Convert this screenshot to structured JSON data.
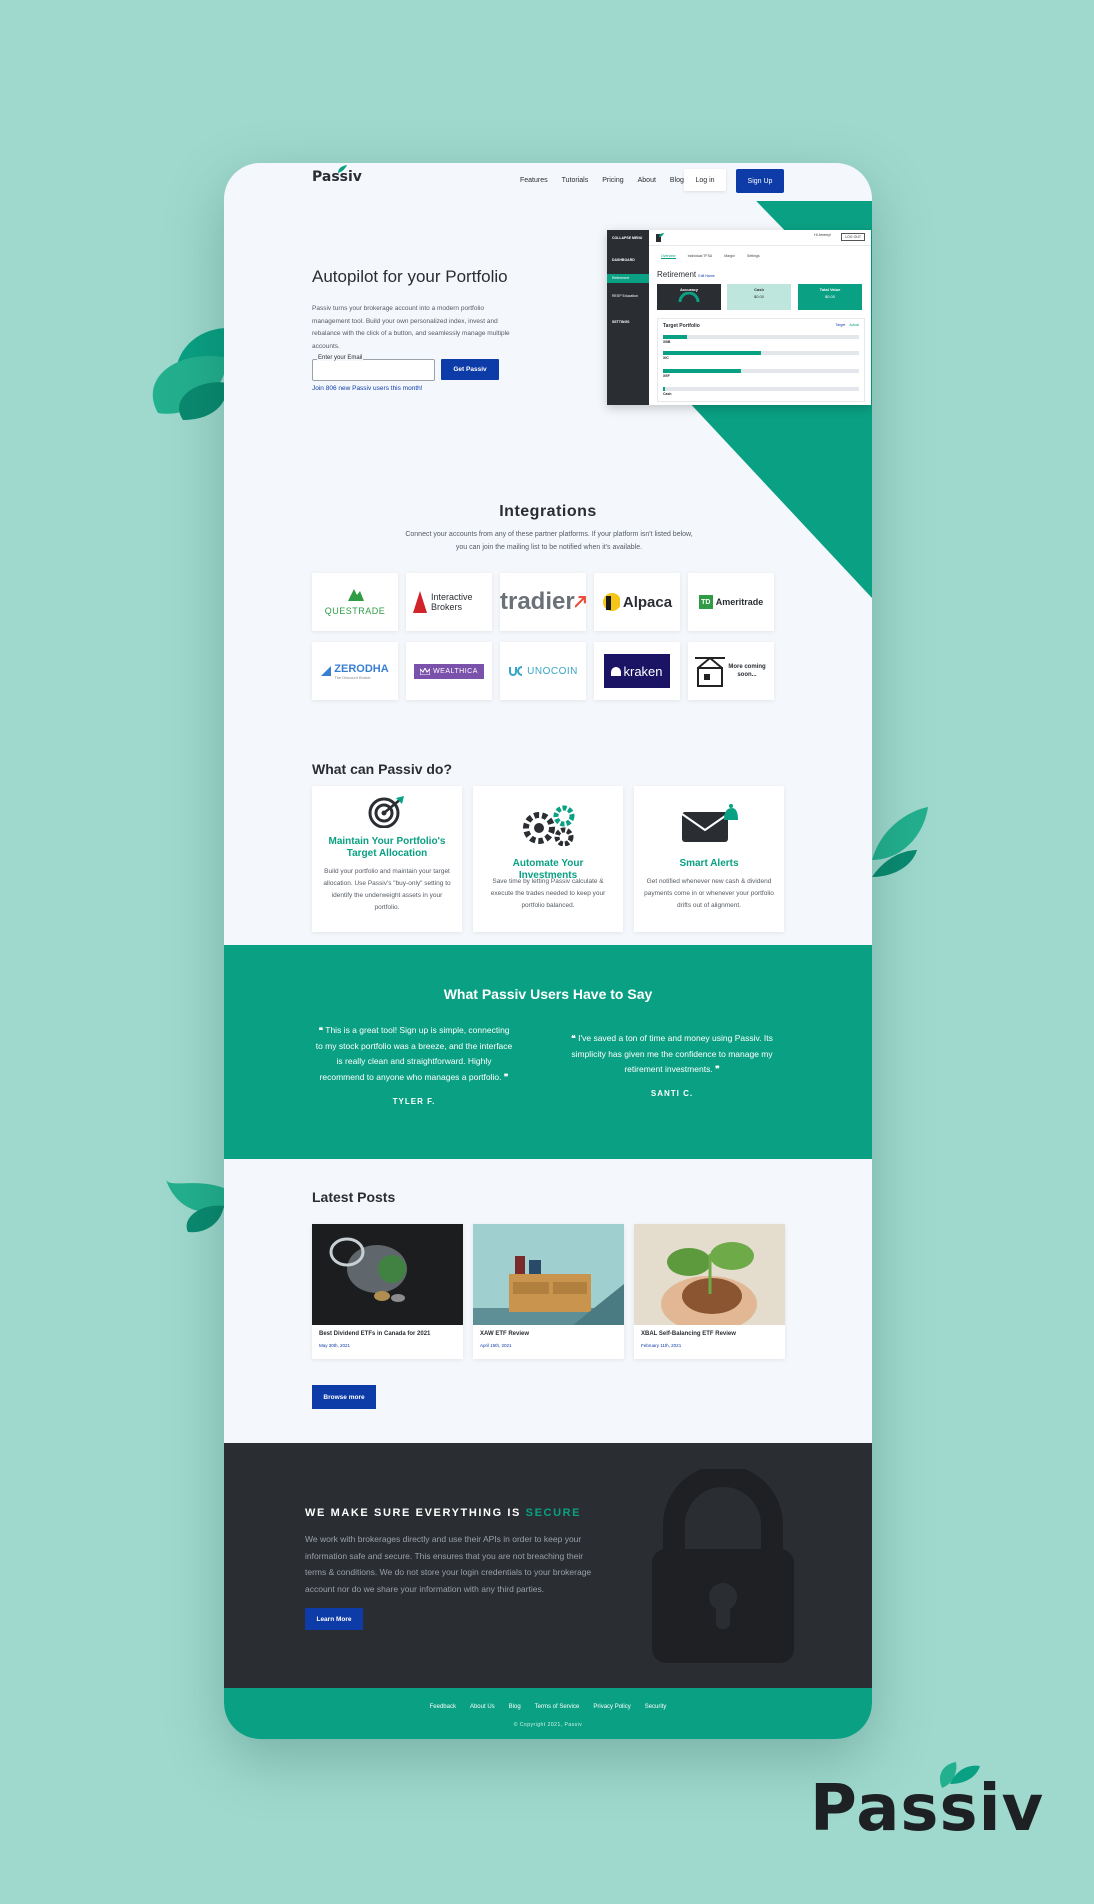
{
  "brand": "Passiv",
  "nav": {
    "links": [
      "Features",
      "Tutorials",
      "Pricing",
      "About",
      "Blog"
    ],
    "login": "Log in",
    "signup": "Sign Up"
  },
  "hero": {
    "title": "Autopilot for your Portfolio",
    "description": "Passiv turns your brokerage account into a modern portfolio management tool. Build your own personalized index, invest and rebalance with the click of a button, and seamlessly manage multiple accounts.",
    "email_label": "Enter your Email",
    "email_value": "",
    "cta": "Get Passiv",
    "join_text": "Join 806 new Passiv users this month!"
  },
  "dashboard": {
    "menu": "COLLAPSE MENU",
    "side_items": [
      "DASHBOARD",
      "Retirement",
      "RESP Education",
      "SETTINGS"
    ],
    "user": "Hi Jeremy!",
    "logout": "LOG OUT",
    "tabs": [
      "Overview",
      "Individual TFSA",
      "Margin",
      "Settings"
    ],
    "title": "Retirement",
    "title_link": "Edit Name",
    "cards": [
      {
        "label": "Accuracy",
        "value": ""
      },
      {
        "label": "Cash",
        "value": "$0.00"
      },
      {
        "label": "Total Value",
        "value": "$0.00"
      }
    ],
    "target_title": "Target Portfolio",
    "legend": [
      "Target",
      "Actual"
    ],
    "holdings": [
      {
        "symbol": "XBB",
        "fill": 0.12
      },
      {
        "symbol": "XIC",
        "fill": 0.5
      },
      {
        "symbol": "XEF",
        "fill": 0.4
      },
      {
        "symbol": "Cash",
        "fill": 0.01
      }
    ]
  },
  "integrations": {
    "title": "Integrations",
    "description": "Connect your accounts from any of these partner platforms. If your platform isn't listed below, you can join the mailing list to be notified when it's available.",
    "partners": [
      "QUESTRADE",
      "Interactive Brokers",
      "tradier",
      "Alpaca",
      "Ameritrade",
      "ZERODHA",
      "WEALTHICA",
      "UNOCOIN",
      "kraken",
      "More coming soon..."
    ],
    "zerodha_sub": "The Discount Broker",
    "td_badge": "TD"
  },
  "features": {
    "title": "What can Passiv do?",
    "items": [
      {
        "title": "Maintain Your Portfolio's Target Allocation",
        "text": "Build your portfolio and maintain your target allocation. Use Passiv's \"buy-only\" setting to identify the underweight assets in your portfolio."
      },
      {
        "title": "Automate Your Investments",
        "text": "Save time by letting Passiv calculate & execute the trades needed to keep your portfolio balanced."
      },
      {
        "title": "Smart Alerts",
        "text": "Get notified whenever new cash & dividend payments come in or whenever your portfolio drifts out of alignment."
      }
    ]
  },
  "testimonials": {
    "title": "What Passiv Users Have to Say",
    "items": [
      {
        "quote": "This is a great tool! Sign up is simple, connecting to my stock portfolio was a breeze, and the interface is really clean and straightforward. Highly recommend to anyone who manages a portfolio.",
        "name": "TYLER F."
      },
      {
        "quote": "I've saved a ton of time and money using Passiv. Its simplicity has given me the confidence to manage my retirement investments.",
        "name": "SANTI C."
      }
    ]
  },
  "posts": {
    "title": "Latest Posts",
    "items": [
      {
        "title": "Best Dividend ETFs in Canada for 2021",
        "date": "May 30th, 2021"
      },
      {
        "title": "XAW ETF Review",
        "date": "April 15th, 2021"
      },
      {
        "title": "XBAL Self-Balancing ETF Review",
        "date": "February 11th, 2021"
      }
    ],
    "browse": "Browse more"
  },
  "secure": {
    "title_prefix": "WE MAKE SURE EVERYTHING IS ",
    "title_accent": "SECURE",
    "text": "We work with brokerages directly and use their APIs in order to keep your information safe and secure. This ensures that you are not breaching their terms & conditions. We do not store your login credentials to your brokerage account nor do we share your information with any third parties.",
    "cta": "Learn More"
  },
  "footer": {
    "links": [
      "Feedback",
      "About Us",
      "Blog",
      "Terms of Service",
      "Privacy Policy",
      "Security"
    ],
    "copyright": "© Copyright 2021, Passiv"
  },
  "colors": {
    "background": "#9fd9cd",
    "accent": "#0aa083",
    "primary": "#0d3ba8",
    "dark": "#2a2d32"
  }
}
